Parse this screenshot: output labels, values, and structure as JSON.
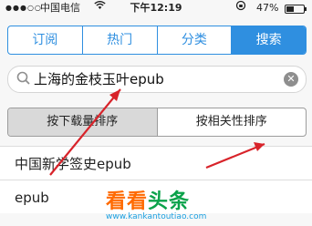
{
  "status": {
    "signal": "●●●○○",
    "carrier": "中国电信",
    "wifi_icon": "wifi-icon",
    "time": "下午12:19",
    "battery_percent": "47%",
    "battery_level": 0.47
  },
  "tabs": [
    {
      "label": "订阅"
    },
    {
      "label": "热门"
    },
    {
      "label": "分类"
    },
    {
      "label": "搜索",
      "active": true
    }
  ],
  "search": {
    "value": "上海的金枝玉叶epub"
  },
  "sort": {
    "options": [
      {
        "label": "按下载量排序",
        "active": true
      },
      {
        "label": "按相关性排序"
      }
    ]
  },
  "results": [
    {
      "title": "中国新学签史epub"
    },
    {
      "title": "epub"
    }
  ],
  "watermark": {
    "logo_text": "看看",
    "logo_head": "头条",
    "url": "www.kankantoutiao.com"
  },
  "colors": {
    "accent": "#2f8fe0",
    "arrow": "#d8232a"
  }
}
